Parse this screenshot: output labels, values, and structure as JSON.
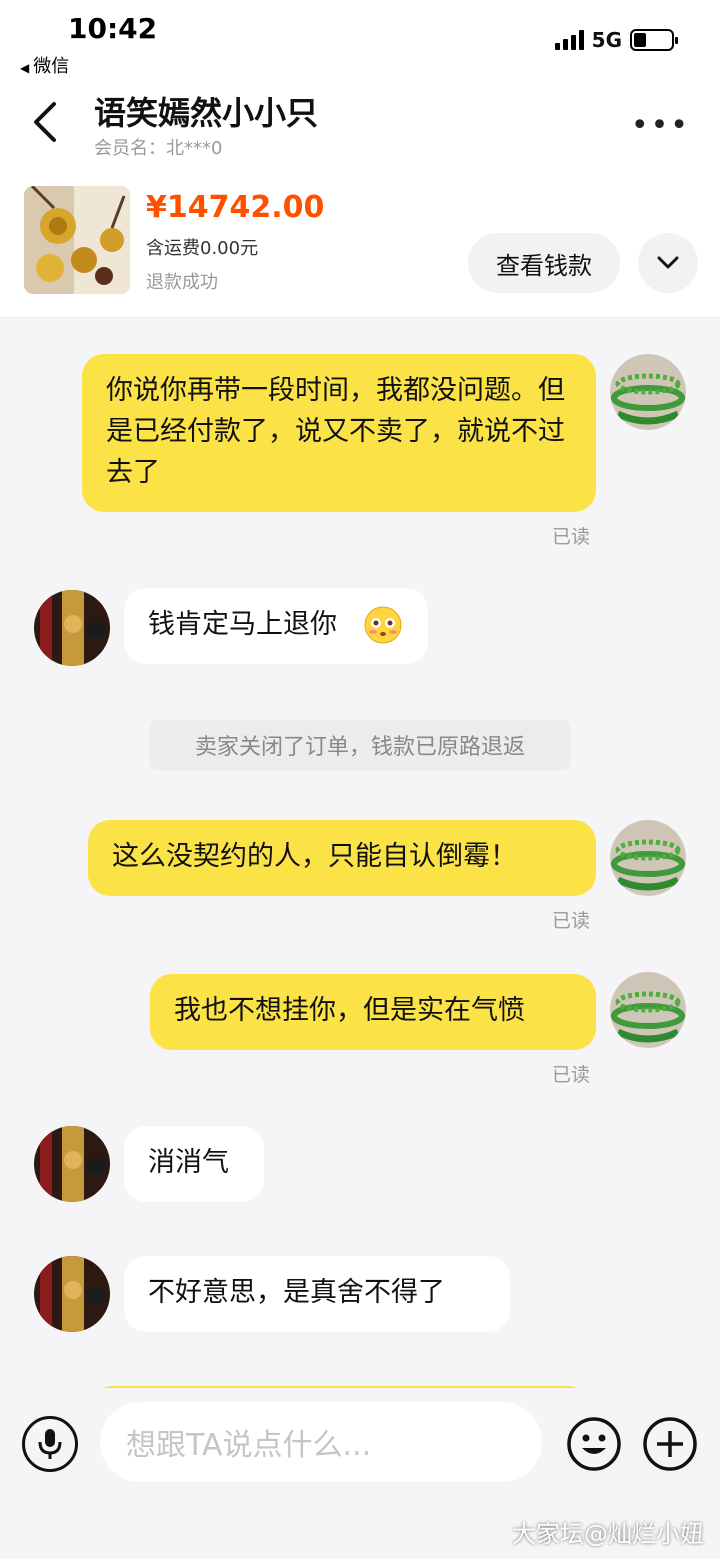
{
  "status": {
    "time": "10:42",
    "back_app": "微信",
    "network": "5G"
  },
  "nav": {
    "title": "语笑嫣然小小只",
    "member": "会员名：北***0"
  },
  "order": {
    "price": "¥14742.00",
    "shipping": "含运费0.00元",
    "status": "退款成功",
    "view_button": "查看钱款"
  },
  "messages": [
    {
      "from": "me",
      "text": "你说你再带一段时间，我都没问题。但是已经付款了，说又不卖了，就说不过去了",
      "read": "已读"
    },
    {
      "from": "them",
      "text": "钱肯定马上退你"
    },
    {
      "from": "system",
      "text": "卖家关闭了订单，钱款已原路退返"
    },
    {
      "from": "me",
      "text": "这么没契约的人，只能自认倒霉！",
      "read": "已读"
    },
    {
      "from": "me",
      "text": "我也不想挂你，但是实在气愤",
      "read": "已读"
    },
    {
      "from": "them",
      "text": "消消气"
    },
    {
      "from": "them",
      "text": "不好意思，是真舍不得了"
    }
  ],
  "input": {
    "placeholder": "想跟TA说点什么..."
  },
  "watermark": "大家坛@灿烂小妞",
  "colors": {
    "price": "#ff5000",
    "my_bubble": "#fbe247",
    "background": "#f5f5f7"
  }
}
